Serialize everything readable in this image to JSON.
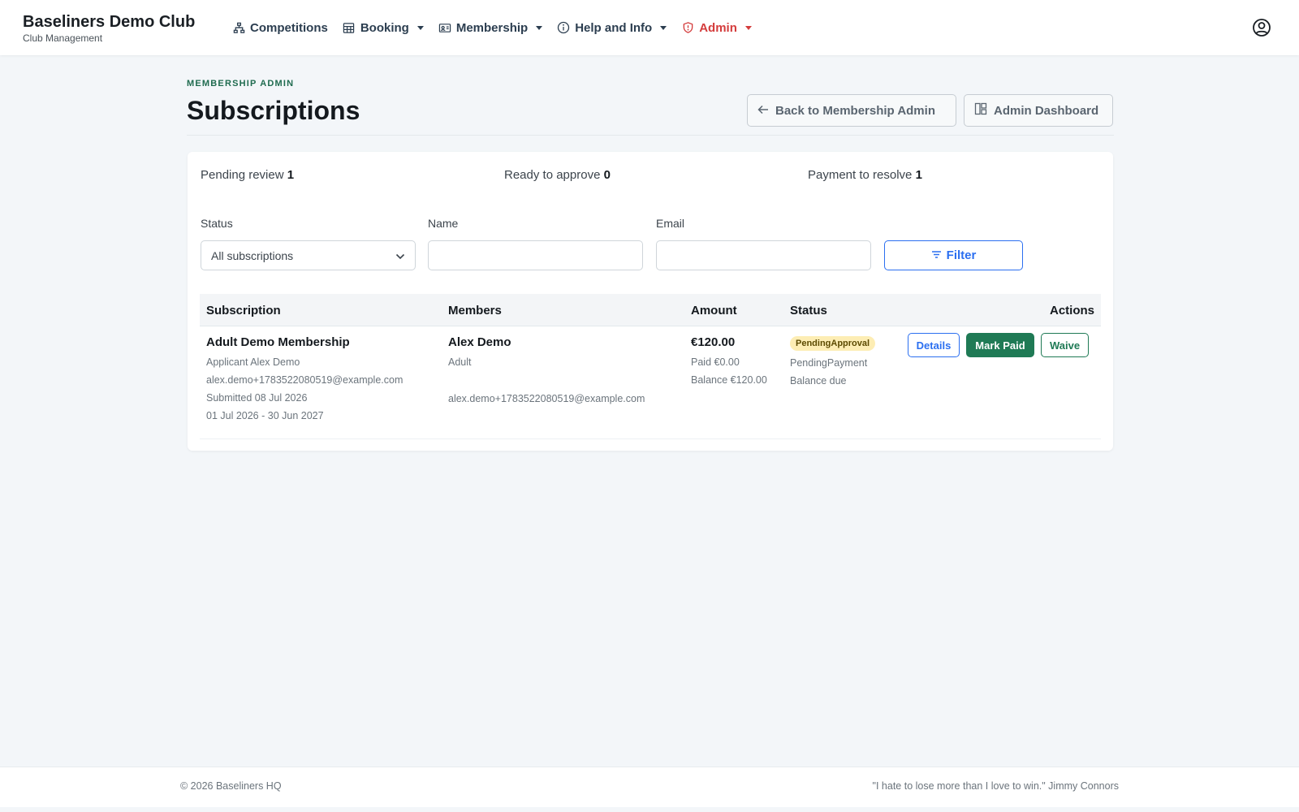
{
  "brand": {
    "name": "Baseliners Demo Club",
    "subtitle": "Club Management"
  },
  "nav": {
    "competitions": "Competitions",
    "booking": "Booking",
    "membership": "Membership",
    "help": "Help and Info",
    "admin": "Admin"
  },
  "header": {
    "eyebrow": "MEMBERSHIP ADMIN",
    "title": "Subscriptions",
    "back_button": "Back to Membership Admin",
    "dashboard_button": "Admin Dashboard"
  },
  "stats": {
    "pending_label": "Pending review",
    "pending_count": "1",
    "ready_label": "Ready to approve",
    "ready_count": "0",
    "payment_label": "Payment to resolve",
    "payment_count": "1"
  },
  "filters": {
    "status_label": "Status",
    "status_value": "All subscriptions",
    "name_label": "Name",
    "name_value": "",
    "email_label": "Email",
    "email_value": "",
    "filter_button": "Filter"
  },
  "table": {
    "headers": {
      "subscription": "Subscription",
      "members": "Members",
      "amount": "Amount",
      "status": "Status",
      "actions": "Actions"
    },
    "rows": [
      {
        "plan": "Adult Demo Membership",
        "applicant": "Applicant Alex Demo",
        "applicant_email": "alex.demo+1783522080519@example.com",
        "submitted": "Submitted 08 Jul 2026",
        "period": "01 Jul 2026 - 30 Jun 2027",
        "member_name": "Alex Demo",
        "member_type": "Adult",
        "member_email": "alex.demo+1783522080519@example.com",
        "amount": "€120.00",
        "paid": "Paid €0.00",
        "balance": "Balance €120.00",
        "status_badge": "PendingApproval",
        "payment_status": "PendingPayment",
        "balance_status": "Balance due",
        "actions": {
          "details": "Details",
          "mark_paid": "Mark Paid",
          "waive": "Waive"
        }
      }
    ]
  },
  "footer": {
    "copyright": "© 2026 Baseliners HQ",
    "quote": "\"I hate to lose more than I love to win.\" Jimmy Connors"
  },
  "colors": {
    "accent_blue": "#2b6ff0",
    "accent_green": "#1f7a55",
    "admin_red": "#d43c3c",
    "badge_yellow": "#fdedb4",
    "background": "#f3f6f9"
  }
}
